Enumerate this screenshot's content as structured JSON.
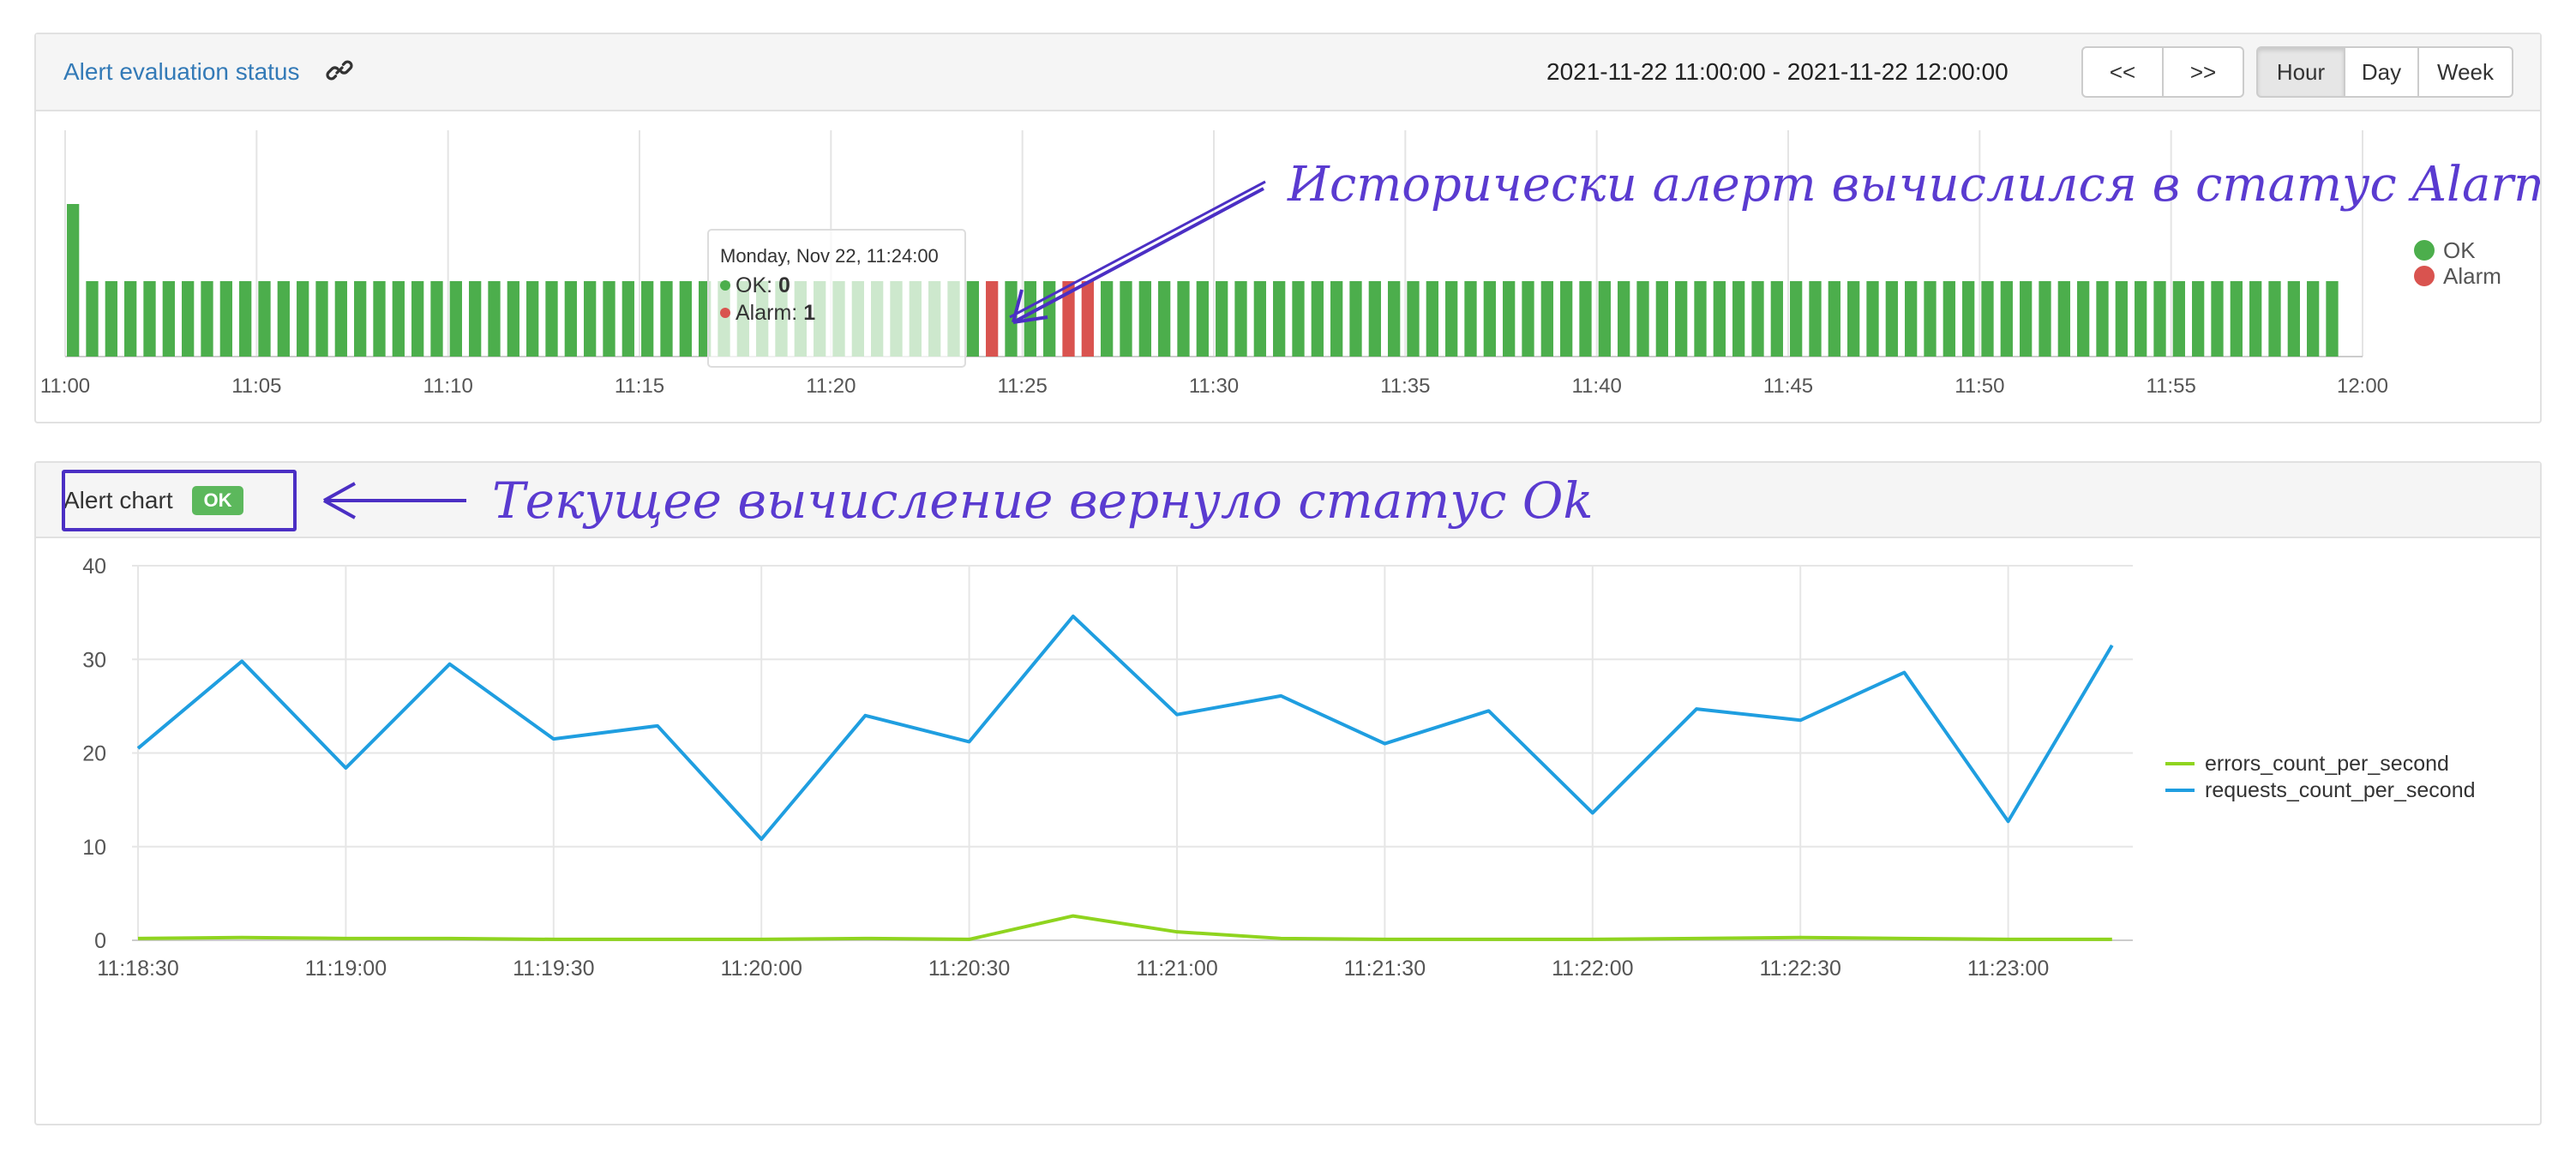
{
  "status_panel": {
    "title": "Alert evaluation status",
    "link_icon": "link-icon",
    "date_range": "2021-11-22 11:00:00 - 2021-11-22 12:00:00",
    "buttons": {
      "prev": "<<",
      "next": ">>",
      "hour": "Hour",
      "day": "Day",
      "week": "Week"
    },
    "active_range": "Hour",
    "annotation": "Исторически алерт вычислился в статус Alarm"
  },
  "status_chart": {
    "type": "bar",
    "x_tick_labels": [
      "11:00",
      "11:05",
      "11:10",
      "11:15",
      "11:20",
      "11:25",
      "11:30",
      "11:35",
      "11:40",
      "11:45",
      "11:50",
      "11:55",
      "12:00"
    ],
    "bars_total": 119,
    "bar_interval_minutes": 0.5,
    "alarm_bar_indices": [
      48,
      52,
      53
    ],
    "first_bar_tall": true,
    "legend": [
      {
        "name": "OK",
        "color": "#4cae4c"
      },
      {
        "name": "Alarm",
        "color": "#d9534f"
      }
    ],
    "tooltip": {
      "title": "Monday, Nov 22, 11:24:00",
      "ok_label": "OK: ",
      "ok_value": "0",
      "alarm_label": "Alarm: ",
      "alarm_value": "1"
    }
  },
  "chart_panel": {
    "title": "Alert chart",
    "badge": "OK",
    "badge_color": "#5cb85c",
    "annotation": "Текущее вычисление вернуло статус Ok"
  },
  "chart_data": {
    "type": "line",
    "x": [
      "11:18:30",
      "11:18:45",
      "11:19:00",
      "11:19:15",
      "11:19:30",
      "11:19:45",
      "11:20:00",
      "11:20:15",
      "11:20:30",
      "11:20:45",
      "11:21:00",
      "11:21:15",
      "11:21:30",
      "11:21:45",
      "11:22:00",
      "11:22:15",
      "11:22:30",
      "11:22:45",
      "11:23:00",
      "11:23:15"
    ],
    "x_tick_labels": [
      "11:18:30",
      "11:19:00",
      "11:19:30",
      "11:20:00",
      "11:20:30",
      "11:21:00",
      "11:21:30",
      "11:22:00",
      "11:22:30",
      "11:23:00"
    ],
    "series": [
      {
        "name": "errors_count_per_second",
        "color": "#8fd41f",
        "values": [
          0.2,
          0.3,
          0.2,
          0.2,
          0.1,
          0.1,
          0.1,
          0.2,
          0.1,
          2.6,
          0.9,
          0.2,
          0.1,
          0.1,
          0.1,
          0.2,
          0.3,
          0.2,
          0.1,
          0.1
        ]
      },
      {
        "name": "requests_count_per_second",
        "color": "#1f9ee0",
        "values": [
          20.5,
          29.8,
          18.4,
          29.5,
          21.5,
          22.9,
          10.8,
          24.0,
          21.2,
          34.6,
          24.1,
          26.1,
          21.0,
          24.5,
          13.6,
          24.7,
          23.5,
          28.6,
          12.7,
          31.5
        ]
      }
    ],
    "ylim": [
      0,
      40
    ],
    "y_ticks": [
      0,
      10,
      20,
      30,
      40
    ],
    "legend_position": "right"
  }
}
